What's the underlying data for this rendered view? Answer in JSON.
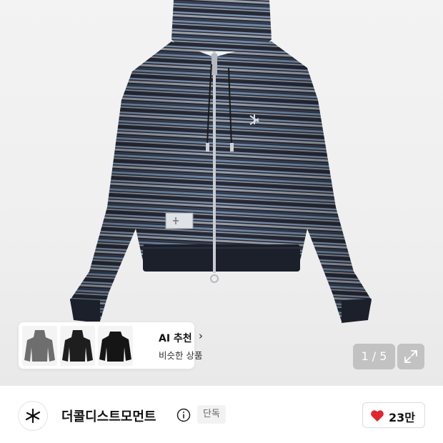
{
  "gallery": {
    "counter": "1 / 5",
    "expand_icon": "expand-icon"
  },
  "ai_recommend": {
    "title": "AI 추천",
    "chevron": "›",
    "subtitle": "비슷한 상품",
    "thumbnails": [
      {
        "icon": "gray-hoodie-thumbnail",
        "color": "#6e6e6e"
      },
      {
        "icon": "black-hoodie-thumbnail",
        "color": "#1e1e1e"
      },
      {
        "icon": "black-jacket-thumbnail",
        "color": "#151515"
      }
    ]
  },
  "brand": {
    "name": "더콜디스트모먼트",
    "badge": "단독",
    "info_icon": "info-icon",
    "logo_icon": "brand-logo-icon"
  },
  "like": {
    "icon": "heart-icon",
    "color": "#e0262f",
    "count": "23만"
  },
  "colors": {
    "stripe_dark": "#262a36",
    "stripe_blue": "#6f88a6",
    "stripe_gray": "#9aa0aa"
  }
}
